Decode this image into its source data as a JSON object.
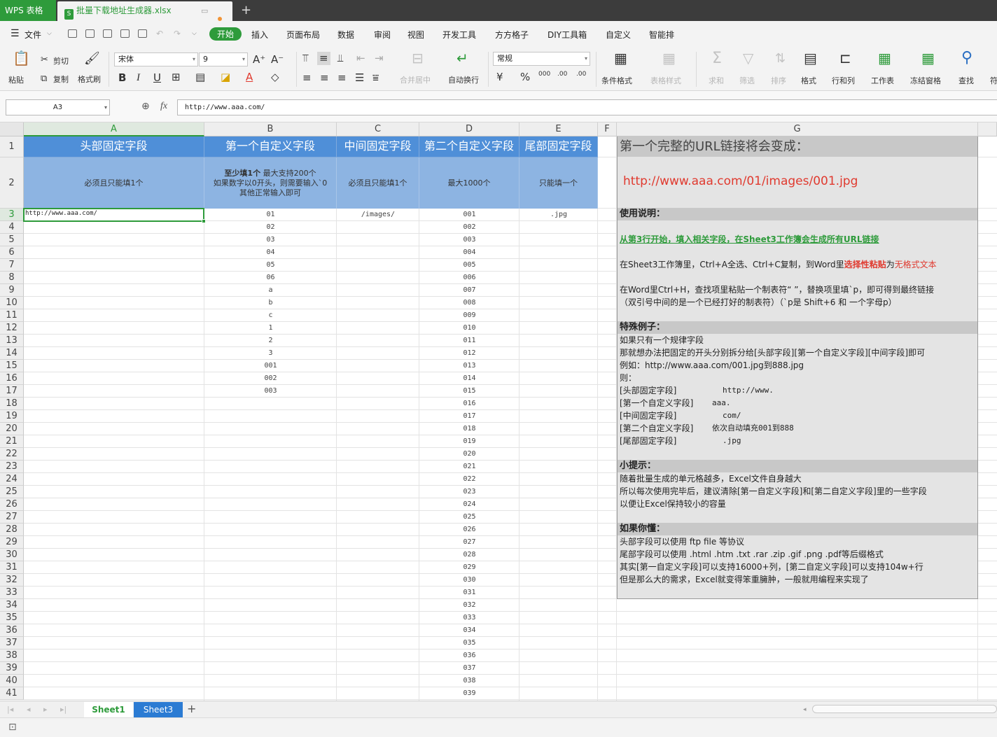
{
  "app": {
    "name": "WPS 表格",
    "file_name": "批量下载地址生成器.xlsx",
    "add_tab": "+"
  },
  "menu": {
    "file": "文件",
    "items": [
      "开始",
      "插入",
      "页面布局",
      "数据",
      "审阅",
      "视图",
      "开发工具",
      "方方格子",
      "DIY工具箱",
      "自定义",
      "智能排"
    ]
  },
  "toolbar": {
    "paste": "粘贴",
    "cut": "剪切",
    "copy": "复制",
    "format_painter": "格式刷",
    "font_name": "宋体",
    "font_size": "9",
    "grow": "A⁺",
    "shrink": "A⁻",
    "bold": "B",
    "italic": "I",
    "underline": "U",
    "merge": "合并居中",
    "wrap": "自动换行",
    "number_format": "常规",
    "percent": "%",
    "thousands": "000",
    "dec_inc": ".00",
    "dec_dec": ".00",
    "cond_format": "条件格式",
    "table_style": "表格样式",
    "sum": "求和",
    "filter": "筛选",
    "sort": "排序",
    "format": "格式",
    "row_col": "行和列",
    "worksheet": "工作表",
    "freeze": "冻结窗格",
    "find": "查找",
    "symbol": "符"
  },
  "formula_bar": {
    "name_box": "A3",
    "fx": "fx",
    "content": "http://www.aaa.com/"
  },
  "columns": [
    "A",
    "B",
    "C",
    "D",
    "E",
    "F",
    "G"
  ],
  "header_row": {
    "A": "头部固定字段",
    "B": "第一个自定义字段",
    "C": "中间固定字段",
    "D": "第二个自定义字段",
    "E": "尾部固定字段"
  },
  "hint_row": {
    "A": "必须且只能填1个",
    "B_bold": "至少填1个",
    "B_rest": " 最大支持200个",
    "B_line2": "如果数字以0开头，则需要输入`0",
    "B_line3": "其他正常输入即可",
    "C": "必须且只能填1个",
    "D": "最大1000个",
    "E": "只能填一个"
  },
  "row_numbers": [
    "1",
    "2",
    "3",
    "4",
    "5",
    "6",
    "7",
    "8",
    "9",
    "10",
    "11",
    "12",
    "13",
    "14",
    "15",
    "16",
    "17",
    "18",
    "19",
    "20",
    "21",
    "22",
    "23",
    "24",
    "25",
    "26",
    "27",
    "28",
    "29",
    "30",
    "31",
    "32",
    "33",
    "34",
    "35",
    "36",
    "37",
    "38",
    "39",
    "40",
    "41"
  ],
  "cells": {
    "A3": "http://www.aaa.com/",
    "B": [
      "01",
      "02",
      "03",
      "04",
      "05",
      "06",
      "a",
      "b",
      "c",
      "1",
      "2",
      "3",
      "001",
      "002",
      "003"
    ],
    "C3": "/images/",
    "D": [
      "001",
      "002",
      "003",
      "004",
      "005",
      "006",
      "007",
      "008",
      "009",
      "010",
      "011",
      "012",
      "013",
      "014",
      "015",
      "016",
      "017",
      "018",
      "019",
      "020",
      "021",
      "022",
      "023",
      "024",
      "025",
      "026",
      "027",
      "028",
      "029",
      "030",
      "031",
      "032",
      "033",
      "034",
      "035",
      "036",
      "037",
      "038",
      "039"
    ],
    "E3": ".jpg"
  },
  "info": {
    "title": "第一个完整的URL链接将会变成：",
    "example_url": "http://www.aaa.com/01/images/001.jpg",
    "usage_title": "使用说明：",
    "usage_green": "从第3行开始，填入相关字段，在Sheet3工作簿会生成所有URL链接",
    "usage_l1a": "在Sheet3工作簿里，Ctrl+A全选、Ctrl+C复制，到Word里",
    "usage_l1b": "选择性粘贴",
    "usage_l1c": "为",
    "usage_l1d": "无格式文本",
    "usage_l2": "在Word里Ctrl+H，查找项里粘贴一个制表符“ ”，替换项里填`p，即可得到最终链接",
    "usage_l3": "（双引号中间的是一个已经打好的制表符）（`p是 Shift+6 和 一个字母p）",
    "special_title": "特殊例子：",
    "special": [
      "如果只有一个规律字段",
      "那就想办法把固定的开头分别拆分给[头部字段][第一个自定义字段][中间字段]即可",
      "例如：http://www.aaa.com/001.jpg到888.jpg",
      "则："
    ],
    "special_map": [
      [
        "[头部固定字段]",
        "http://www."
      ],
      [
        "[第一个自定义字段]",
        "aaa."
      ],
      [
        "[中间固定字段]",
        "com/"
      ],
      [
        "[第二个自定义字段]",
        "依次自动填充001到888"
      ],
      [
        "[尾部固定字段]",
        ".jpg"
      ]
    ],
    "tips_title": "小提示：",
    "tips": [
      "随着批量生成的单元格越多，Excel文件自身越大",
      "所以每次使用完毕后，建议清除[第一自定义字段]和[第二自定义字段]里的一些字段",
      "以便让Excel保持较小的容量"
    ],
    "pro_title": "如果你懂：",
    "pro": [
      "头部字段可以使用 ftp file 等协议",
      "尾部字段可以使用 .html .htm .txt .rar .zip .gif .png .pdf等后缀格式",
      "其实[第一自定义字段]可以支持16000+列，[第二自定义字段]可以支持104w+行",
      "但是那么大的需求，Excel就变得笨重臃肿，一般就用编程来实现了"
    ]
  },
  "sheets": [
    "Sheet1",
    "Sheet3"
  ],
  "colors": {
    "brand_green": "#2e9b3b",
    "header_blue": "#4f8fd8",
    "hint_blue": "#8db4e2",
    "url_red": "#e03a2f"
  }
}
